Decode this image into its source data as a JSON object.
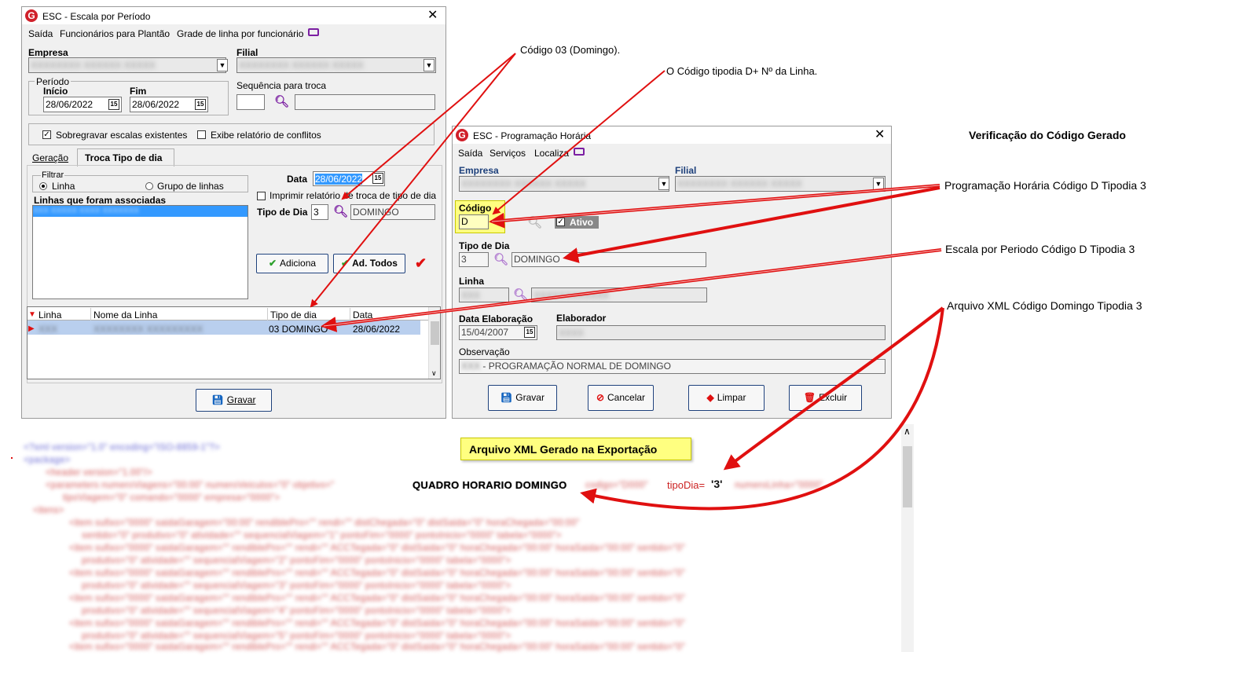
{
  "win1": {
    "title": "ESC - Escala por Período",
    "menu": [
      "Saída",
      "Funcionários para Plantão",
      "Grade de linha por funcionário"
    ],
    "empresa_label": "Empresa",
    "filial_label": "Filial",
    "periodo_label": "Período",
    "inicio_label": "Início",
    "fim_label": "Fim",
    "inicio_value": "28/06/2022",
    "fim_value": "28/06/2022",
    "sequencia_label": "Sequência para troca",
    "sobrescrever_label": "Sobregravar escalas existentes",
    "exibe_label": "Exibe relatório de conflitos",
    "tabs": [
      "Geração",
      "Troca Tipo de dia"
    ],
    "filtrar_label": "Filtrar",
    "radio_linha": "Linha",
    "radio_grupo": "Grupo de linhas",
    "linhas_label": "Linhas que foram associadas",
    "data_label": "Data",
    "data_value": "28/06/2022",
    "imprimir_label": "Imprimir relatório de troca de tipo de dia",
    "tipo_dia_label": "Tipo de Dia",
    "tipo_dia_value": "3",
    "tipo_dia_desc": "DOMINGO",
    "adiciona_label": "Adiciona",
    "ad_todos_label": "Ad. Todos",
    "grid_headers": [
      "Linha",
      "Nome da Linha",
      "Tipo de dia",
      "Data"
    ],
    "grid_row": {
      "tipo": "03 DOMINGO",
      "data": "28/06/2022"
    },
    "gravar_label": "Gravar"
  },
  "win2": {
    "title": "ESC - Programação Horária",
    "menu": [
      "Saída",
      "Serviços",
      "Localiza"
    ],
    "empresa_label": "Empresa",
    "filial_label": "Filial",
    "codigo_label": "Código",
    "codigo_value": "D",
    "ativo_label": "Ativo",
    "tipo_dia_label": "Tipo de Dia",
    "tipo_dia_value": "3",
    "tipo_dia_desc": "DOMINGO",
    "linha_label": "Linha",
    "data_elab_label": "Data Elaboração",
    "data_elab_value": "15/04/2007",
    "elaborador_label": "Elaborador",
    "observacao_label": "Observação",
    "observacao_value": "- PROGRAMAÇÃO NORMAL DE DOMINGO",
    "buttons": [
      "Gravar",
      "Cancelar",
      "Limpar",
      "Excluir"
    ]
  },
  "annotations": {
    "codigo03": "Código 03 (Domingo).",
    "codigo_tipodia": "O Código tipodia D+ Nº da Linha.",
    "verificacao": "Verificação do Código Gerado",
    "prog_horaria": "Programação Horária Código D Tipodia 3",
    "escala_periodo": "Escala por Periodo Código D Tipodia 3",
    "arquivo_xml": "Arquivo XML Código Domingo Tipodia 3",
    "xml_banner": "Arquivo XML Gerado na Exportação"
  },
  "xml": {
    "quadro": "QUADRO HORARIO DOMINGO",
    "tipodia_attr": "tipoDia=",
    "tipodia_value": "'3'"
  },
  "colors": {
    "accent_red": "#e01010",
    "banner_yellow": "#ffff80",
    "highlight_blue": "#3399ff"
  }
}
